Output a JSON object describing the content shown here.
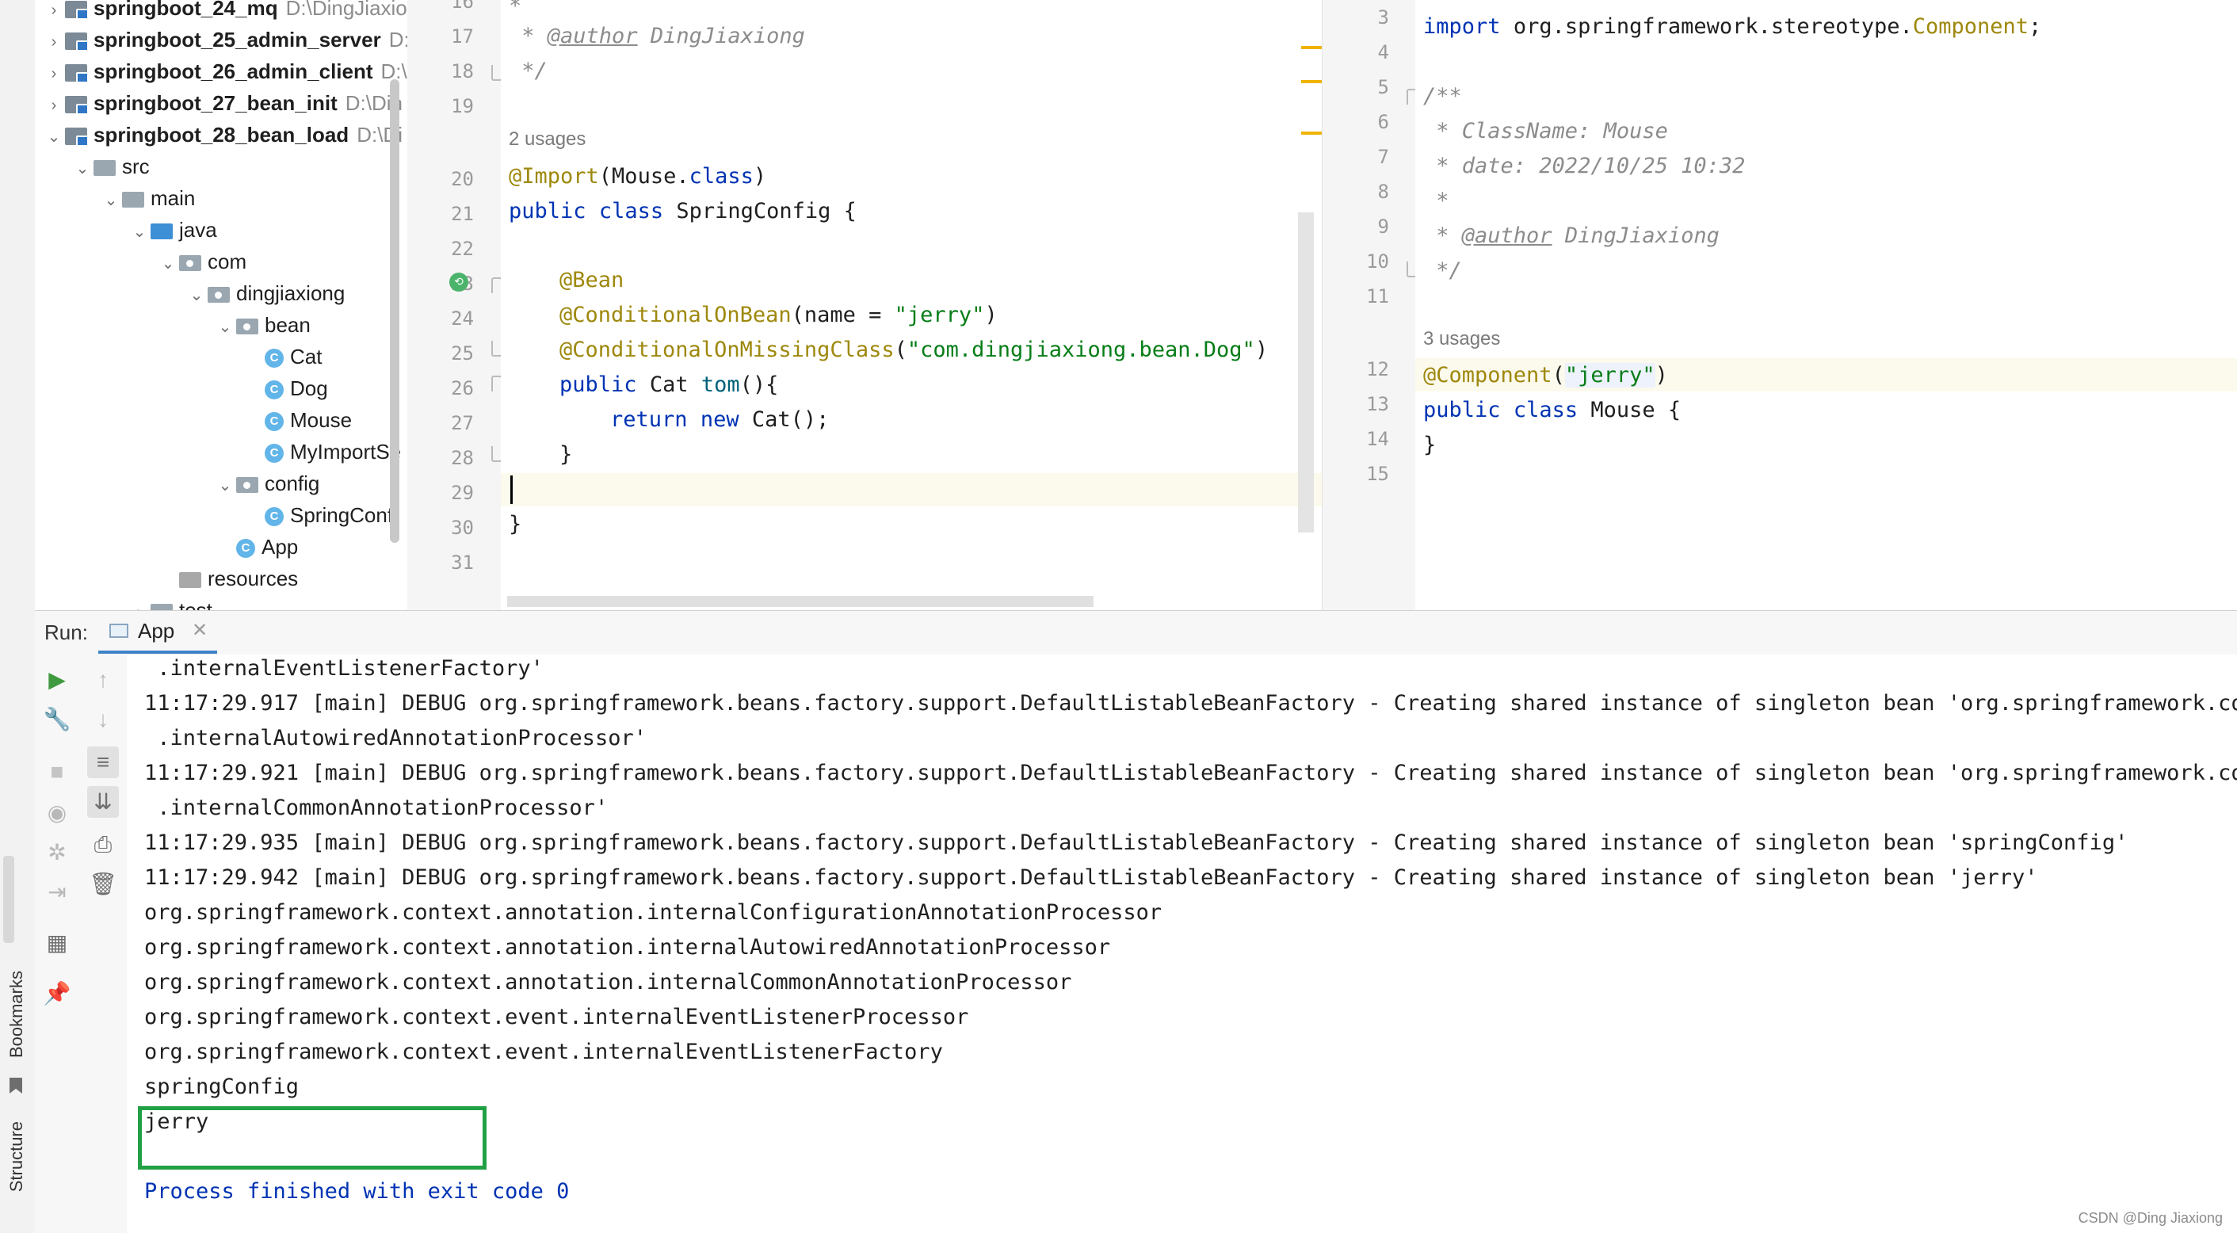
{
  "project_tree": {
    "items": [
      {
        "label": "springboot_24_mq",
        "path": "D:\\DingJiaxio",
        "bold": true,
        "depth": 0,
        "arrow": ">",
        "icon": "module-folder-icon"
      },
      {
        "label": "springboot_25_admin_server",
        "path": "D:",
        "bold": true,
        "depth": 0,
        "arrow": ">",
        "icon": "module-folder-icon"
      },
      {
        "label": "springboot_26_admin_client",
        "path": "D:\\",
        "bold": true,
        "depth": 0,
        "arrow": ">",
        "icon": "module-folder-icon"
      },
      {
        "label": "springboot_27_bean_init",
        "path": "D:\\Din",
        "bold": true,
        "depth": 0,
        "arrow": ">",
        "icon": "module-folder-icon"
      },
      {
        "label": "springboot_28_bean_load",
        "path": "D:\\Di",
        "bold": true,
        "depth": 0,
        "arrow": "v",
        "icon": "module-folder-icon"
      },
      {
        "label": "src",
        "path": "",
        "bold": false,
        "depth": 1,
        "arrow": "v",
        "icon": "folder-icon"
      },
      {
        "label": "main",
        "path": "",
        "bold": false,
        "depth": 2,
        "arrow": "v",
        "icon": "folder-icon"
      },
      {
        "label": "java",
        "path": "",
        "bold": false,
        "depth": 3,
        "arrow": "v",
        "icon": "source-folder-icon"
      },
      {
        "label": "com",
        "path": "",
        "bold": false,
        "depth": 4,
        "arrow": "v",
        "icon": "package-icon"
      },
      {
        "label": "dingjiaxiong",
        "path": "",
        "bold": false,
        "depth": 5,
        "arrow": "v",
        "icon": "package-icon"
      },
      {
        "label": "bean",
        "path": "",
        "bold": false,
        "depth": 6,
        "arrow": "v",
        "icon": "package-icon"
      },
      {
        "label": "Cat",
        "path": "",
        "bold": false,
        "depth": 7,
        "arrow": "",
        "icon": "class-icon"
      },
      {
        "label": "Dog",
        "path": "",
        "bold": false,
        "depth": 7,
        "arrow": "",
        "icon": "class-icon"
      },
      {
        "label": "Mouse",
        "path": "",
        "bold": false,
        "depth": 7,
        "arrow": "",
        "icon": "class-icon"
      },
      {
        "label": "MyImportSe",
        "path": "",
        "bold": false,
        "depth": 7,
        "arrow": "",
        "icon": "class-icon"
      },
      {
        "label": "config",
        "path": "",
        "bold": false,
        "depth": 6,
        "arrow": "v",
        "icon": "package-icon"
      },
      {
        "label": "SpringConf",
        "path": "",
        "bold": false,
        "depth": 7,
        "arrow": "",
        "icon": "class-icon"
      },
      {
        "label": "App",
        "path": "",
        "bold": false,
        "depth": 6,
        "arrow": "",
        "icon": "class-icon"
      },
      {
        "label": "resources",
        "path": "",
        "bold": false,
        "depth": 4,
        "arrow": "",
        "icon": "resources-folder-icon"
      },
      {
        "label": "test",
        "path": "",
        "bold": false,
        "depth": 3,
        "arrow": ">",
        "icon": "folder-icon"
      }
    ]
  },
  "left_editor": {
    "line_numbers": [
      "16",
      "17",
      "18",
      "19",
      "20",
      "21",
      "22",
      "23",
      "24",
      "25",
      "26",
      "27",
      "28",
      "29",
      "30",
      "31"
    ],
    "usages": "2 usages",
    "lines": {
      "l16": "*",
      "l17_prefix": " * ",
      "l17_tag": "@author",
      "l17_rest": " DingJiaxiong",
      "l18": " */",
      "l20_ann": "@Import",
      "l20_rest": "(Mouse.",
      "l20_kw": "class",
      "l20_end": ")",
      "l21_kw1": "public",
      "l21_kw2": "class",
      "l21_rest": "SpringConfig {",
      "l23": "@Bean",
      "l24_ann": "@ConditionalOnBean",
      "l24_rest": "(name = ",
      "l24_str": "\"jerry\"",
      "l24_end": ")",
      "l25_ann": "@ConditionalOnMissingClass",
      "l25_open": "(",
      "l25_str": "\"com.dingjiaxiong.bean.Dog\"",
      "l25_end": ")",
      "l26_kw": "public",
      "l26_rest": "Cat ",
      "l26_method": "tom",
      "l26_end": "(){",
      "l27_kw1": "return",
      "l27_kw2": "new",
      "l27_rest": "Cat();",
      "l28": "}",
      "l30": "}"
    }
  },
  "right_editor": {
    "line_numbers": [
      "3",
      "4",
      "5",
      "6",
      "7",
      "8",
      "9",
      "10",
      "11",
      "12",
      "13",
      "14",
      "15"
    ],
    "usages": "3 usages",
    "lines": {
      "l3_kw": "import",
      "l3_rest": "org.springframework.stereotype.",
      "l3_cls": "Component",
      "l3_end": ";",
      "l5": "/**",
      "l6": " * ClassName: Mouse",
      "l7": " * date: 2022/10/25 10:32",
      "l8": " *",
      "l9_prefix": " * ",
      "l9_tag": "@author",
      "l9_rest": " DingJiaxiong",
      "l10": " */",
      "l12_ann": "@Component",
      "l12_open": "(",
      "l12_str": "\"jerry\"",
      "l12_end": ")",
      "l13_kw1": "public",
      "l13_kw2": "class",
      "l13_rest": "Mouse {",
      "l14": "}"
    }
  },
  "run_panel": {
    "label": "Run:",
    "tab": "App",
    "console_lines": [
      " .internalEventListenerFactory'",
      "11:17:29.917 [main] DEBUG org.springframework.beans.factory.support.DefaultListableBeanFactory - Creating shared instance of singleton bean 'org.springframework.cont",
      " .internalAutowiredAnnotationProcessor'",
      "11:17:29.921 [main] DEBUG org.springframework.beans.factory.support.DefaultListableBeanFactory - Creating shared instance of singleton bean 'org.springframework.cont",
      " .internalCommonAnnotationProcessor'",
      "11:17:29.935 [main] DEBUG org.springframework.beans.factory.support.DefaultListableBeanFactory - Creating shared instance of singleton bean 'springConfig'",
      "11:17:29.942 [main] DEBUG org.springframework.beans.factory.support.DefaultListableBeanFactory - Creating shared instance of singleton bean 'jerry'",
      "org.springframework.context.annotation.internalConfigurationAnnotationProcessor",
      "org.springframework.context.annotation.internalAutowiredAnnotationProcessor",
      "org.springframework.context.annotation.internalCommonAnnotationProcessor",
      "org.springframework.context.event.internalEventListenerProcessor",
      "org.springframework.context.event.internalEventListenerFactory",
      "springConfig",
      "jerry",
      "",
      "Process finished with exit code 0"
    ]
  },
  "side_labels": {
    "bookmarks": "Bookmarks",
    "structure": "Structure"
  },
  "watermark": "CSDN @Ding Jiaxiong",
  "colors": {
    "keyword": "#0033b3",
    "annotation": "#9e880d",
    "string": "#067d17",
    "highlight_box": "#22a046",
    "process_finished": "#0033b3"
  }
}
